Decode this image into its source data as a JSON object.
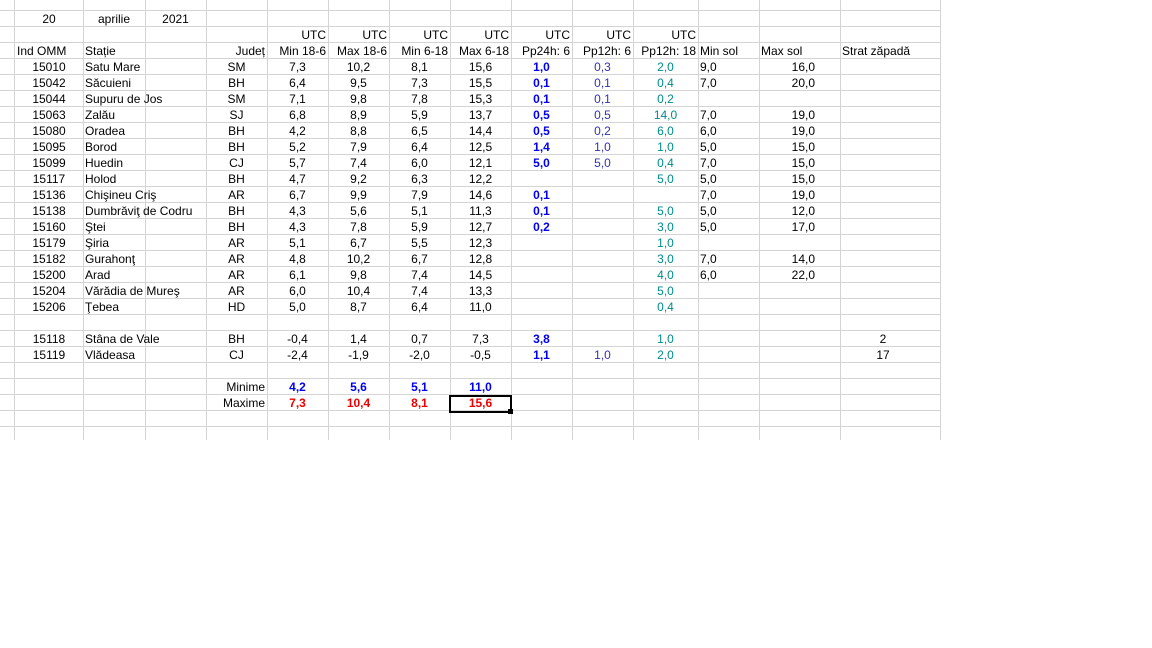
{
  "date": {
    "day": "20",
    "month": "aprilie",
    "year": "2021"
  },
  "utc_label": "UTC",
  "headers": {
    "ind_omm": "Ind OMM",
    "statie": "Stație",
    "judet": "Județ",
    "min_18_6": "Min 18-6",
    "max_18_6": "Max 18-6",
    "min_6_18": "Min 6-18",
    "max_6_18": "Max 6-18",
    "pp24h_6": "Pp24h: 6",
    "pp12h_6": "Pp12h: 6",
    "pp12h_18": "Pp12h: 18",
    "min_sol": "Min sol",
    "max_sol": "Max sol",
    "strat_zapada": "Strat zăpadă"
  },
  "rows": [
    {
      "id": "15010",
      "station": "Satu Mare",
      "county": "SM",
      "min18": "7,3",
      "max18": "10,2",
      "min6": "8,1",
      "max6": "15,6",
      "pp24": "1,0",
      "pp12_6": "0,3",
      "pp12_18": "2,0",
      "minsol": "9,0",
      "maxsol": "16,0",
      "snow": ""
    },
    {
      "id": "15042",
      "station": "Săcuieni",
      "county": "BH",
      "min18": "6,4",
      "max18": "9,5",
      "min6": "7,3",
      "max6": "15,5",
      "pp24": "0,1",
      "pp12_6": "0,1",
      "pp12_18": "0,4",
      "minsol": "7,0",
      "maxsol": "20,0",
      "snow": ""
    },
    {
      "id": "15044",
      "station": "Supuru de Jos",
      "county": "SM",
      "min18": "7,1",
      "max18": "9,8",
      "min6": "7,8",
      "max6": "15,3",
      "pp24": "0,1",
      "pp12_6": "0,1",
      "pp12_18": "0,2",
      "minsol": "",
      "maxsol": "",
      "snow": ""
    },
    {
      "id": "15063",
      "station": "Zalău",
      "county": "SJ",
      "min18": "6,8",
      "max18": "8,9",
      "min6": "5,9",
      "max6": "13,7",
      "pp24": "0,5",
      "pp12_6": "0,5",
      "pp12_18": "14,0",
      "minsol": "7,0",
      "maxsol": "19,0",
      "snow": ""
    },
    {
      "id": "15080",
      "station": "Oradea",
      "county": "BH",
      "min18": "4,2",
      "max18": "8,8",
      "min6": "6,5",
      "max6": "14,4",
      "pp24": "0,5",
      "pp12_6": "0,2",
      "pp12_18": "6,0",
      "minsol": "6,0",
      "maxsol": "19,0",
      "snow": ""
    },
    {
      "id": "15095",
      "station": "Borod",
      "county": "BH",
      "min18": "5,2",
      "max18": "7,9",
      "min6": "6,4",
      "max6": "12,5",
      "pp24": "1,4",
      "pp12_6": "1,0",
      "pp12_18": "1,0",
      "minsol": "5,0",
      "maxsol": "15,0",
      "snow": ""
    },
    {
      "id": "15099",
      "station": "Huedin",
      "county": "CJ",
      "min18": "5,7",
      "max18": "7,4",
      "min6": "6,0",
      "max6": "12,1",
      "pp24": "5,0",
      "pp12_6": "5,0",
      "pp12_18": "0,4",
      "minsol": "7,0",
      "maxsol": "15,0",
      "snow": ""
    },
    {
      "id": "15117",
      "station": "Holod",
      "county": "BH",
      "min18": "4,7",
      "max18": "9,2",
      "min6": "6,3",
      "max6": "12,2",
      "pp24": "",
      "pp12_6": "",
      "pp12_18": "5,0",
      "minsol": "5,0",
      "maxsol": "15,0",
      "snow": ""
    },
    {
      "id": "15136",
      "station": "Chişineu   Criş",
      "county": "AR",
      "min18": "6,7",
      "max18": "9,9",
      "min6": "7,9",
      "max6": "14,6",
      "pp24": "0,1",
      "pp12_6": "",
      "pp12_18": "",
      "minsol": "7,0",
      "maxsol": "19,0",
      "snow": ""
    },
    {
      "id": "15138",
      "station": "Dumbrăviţ  de Codru",
      "county": "BH",
      "min18": "4,3",
      "max18": "5,6",
      "min6": "5,1",
      "max6": "11,3",
      "pp24": "0,1",
      "pp12_6": "",
      "pp12_18": "5,0",
      "minsol": "5,0",
      "maxsol": "12,0",
      "snow": ""
    },
    {
      "id": "15160",
      "station": "Ştei",
      "county": "BH",
      "min18": "4,3",
      "max18": "7,8",
      "min6": "5,9",
      "max6": "12,7",
      "pp24": "0,2",
      "pp12_6": "",
      "pp12_18": "3,0",
      "minsol": "5,0",
      "maxsol": "17,0",
      "snow": ""
    },
    {
      "id": "15179",
      "station": "Şiria",
      "county": "AR",
      "min18": "5,1",
      "max18": "6,7",
      "min6": "5,5",
      "max6": "12,3",
      "pp24": "",
      "pp12_6": "",
      "pp12_18": "1,0",
      "minsol": "",
      "maxsol": "",
      "snow": ""
    },
    {
      "id": "15182",
      "station": "Gurahonţ",
      "county": "AR",
      "min18": "4,8",
      "max18": "10,2",
      "min6": "6,7",
      "max6": "12,8",
      "pp24": "",
      "pp12_6": "",
      "pp12_18": "3,0",
      "minsol": "7,0",
      "maxsol": "14,0",
      "snow": ""
    },
    {
      "id": "15200",
      "station": "Arad",
      "county": "AR",
      "min18": "6,1",
      "max18": "9,8",
      "min6": "7,4",
      "max6": "14,5",
      "pp24": "",
      "pp12_6": "",
      "pp12_18": "4,0",
      "minsol": "6,0",
      "maxsol": "22,0",
      "snow": ""
    },
    {
      "id": "15204",
      "station": "Vărădia de Mureş",
      "county": "AR",
      "min18": "6,0",
      "max18": "10,4",
      "min6": "7,4",
      "max6": "13,3",
      "pp24": "",
      "pp12_6": "",
      "pp12_18": "5,0",
      "minsol": "",
      "maxsol": "",
      "snow": ""
    },
    {
      "id": "15206",
      "station": "Ţebea",
      "county": "HD",
      "min18": "5,0",
      "max18": "8,7",
      "min6": "6,4",
      "max6": "11,0",
      "pp24": "",
      "pp12_6": "",
      "pp12_18": "0,4",
      "minsol": "",
      "maxsol": "",
      "snow": ""
    },
    {
      "id": "",
      "station": "",
      "county": "",
      "min18": "",
      "max18": "",
      "min6": "",
      "max6": "",
      "pp24": "",
      "pp12_6": "",
      "pp12_18": "",
      "minsol": "",
      "maxsol": "",
      "snow": ""
    },
    {
      "id": "15118",
      "station": "Stâna de Vale",
      "county": "BH",
      "min18": "-0,4",
      "max18": "1,4",
      "min6": "0,7",
      "max6": "7,3",
      "pp24": "3,8",
      "pp12_6": "",
      "pp12_18": "1,0",
      "minsol": "",
      "maxsol": "",
      "snow": "2"
    },
    {
      "id": "15119",
      "station": "Vlădeasa",
      "county": "CJ",
      "min18": "-2,4",
      "max18": "-1,9",
      "min6": "-2,0",
      "max6": "-0,5",
      "pp24": "1,1",
      "pp12_6": "1,0",
      "pp12_18": "2,0",
      "minsol": "",
      "maxsol": "",
      "snow": "17"
    }
  ],
  "summary": {
    "minime_label": "Minime",
    "minime": [
      "4,2",
      "5,6",
      "5,1",
      "11,0"
    ],
    "maxime_label": "Maxime",
    "maxime": [
      "7,3",
      "10,4",
      "8,1",
      "15,6"
    ]
  },
  "colors": {
    "grid": "#d4d4d4",
    "min_values": "#0000ee",
    "max_values": "#ee0000",
    "pp12h_18": "#008b8b",
    "pp12h_6": "#3333aa"
  }
}
